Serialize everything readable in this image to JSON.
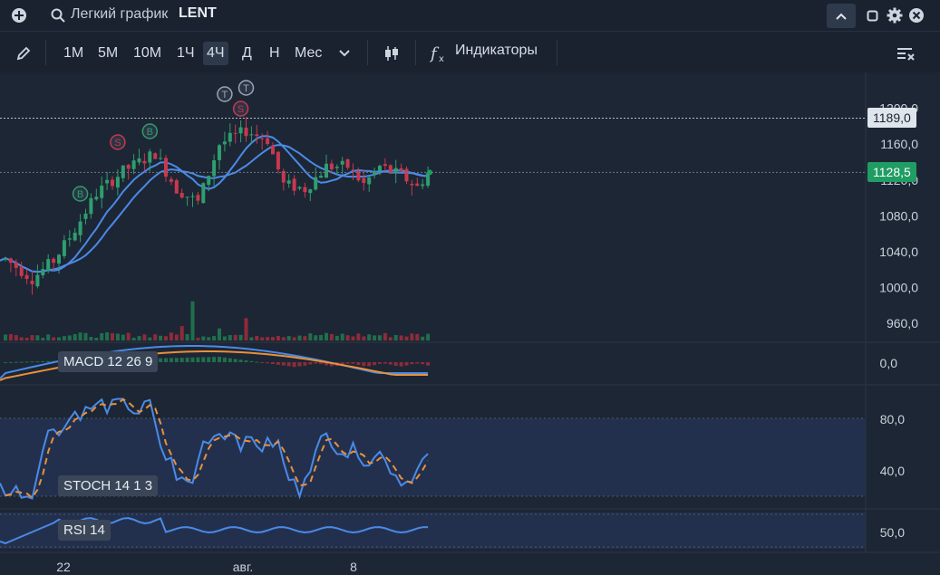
{
  "header": {
    "search_placeholder": "Легкий график",
    "ticker": "LENT"
  },
  "toolbar": {
    "timeframes": [
      "1М",
      "5М",
      "10М",
      "1Ч",
      "4Ч",
      "Д",
      "Н",
      "Мес"
    ],
    "active_timeframe": "4Ч",
    "indicators_label": "Индикаторы"
  },
  "chart_data": {
    "type": "candlestick",
    "symbol": "LENT",
    "price_axis": {
      "labels": [
        "1200,0",
        "1160,0",
        "1120,0",
        "1080,0",
        "1040,0",
        "1000,0",
        "960,0"
      ],
      "ticks": [
        1200,
        1160,
        1120,
        1080,
        1040,
        1000,
        960
      ],
      "range": [
        945,
        1235
      ]
    },
    "reference_line": {
      "label": "1189,0",
      "value": 1189
    },
    "last_price": {
      "label": "1128,5",
      "value": 1128.5
    },
    "x_axis_labels": [
      "22",
      "авг.",
      "8"
    ],
    "signals": [
      {
        "text": "S",
        "kind": "sell",
        "bar": 21
      },
      {
        "text": "B",
        "kind": "buy",
        "bar": 27
      },
      {
        "text": "B",
        "kind": "buy",
        "bar": 14
      },
      {
        "text": "T",
        "kind": "take",
        "bar": 41
      },
      {
        "text": "T",
        "kind": "take",
        "bar": 45
      },
      {
        "text": "S",
        "kind": "sell",
        "bar": 44
      }
    ],
    "panes": {
      "macd": {
        "label": "MACD 12 26 9",
        "axis_labels": [
          "0,0"
        ]
      },
      "stoch": {
        "label": "STOCH 14 1 3",
        "axis_labels": [
          "80,0",
          "40,0"
        ],
        "levels": [
          80,
          20
        ]
      },
      "rsi": {
        "label": "RSI 14",
        "axis_labels": [
          "50,0"
        ]
      }
    },
    "colors": {
      "up": "#2e9e6e",
      "down": "#c8384e",
      "ma": "#4a8ae8",
      "signal": "#e8913a",
      "last_price": "#1f9d63"
    }
  }
}
